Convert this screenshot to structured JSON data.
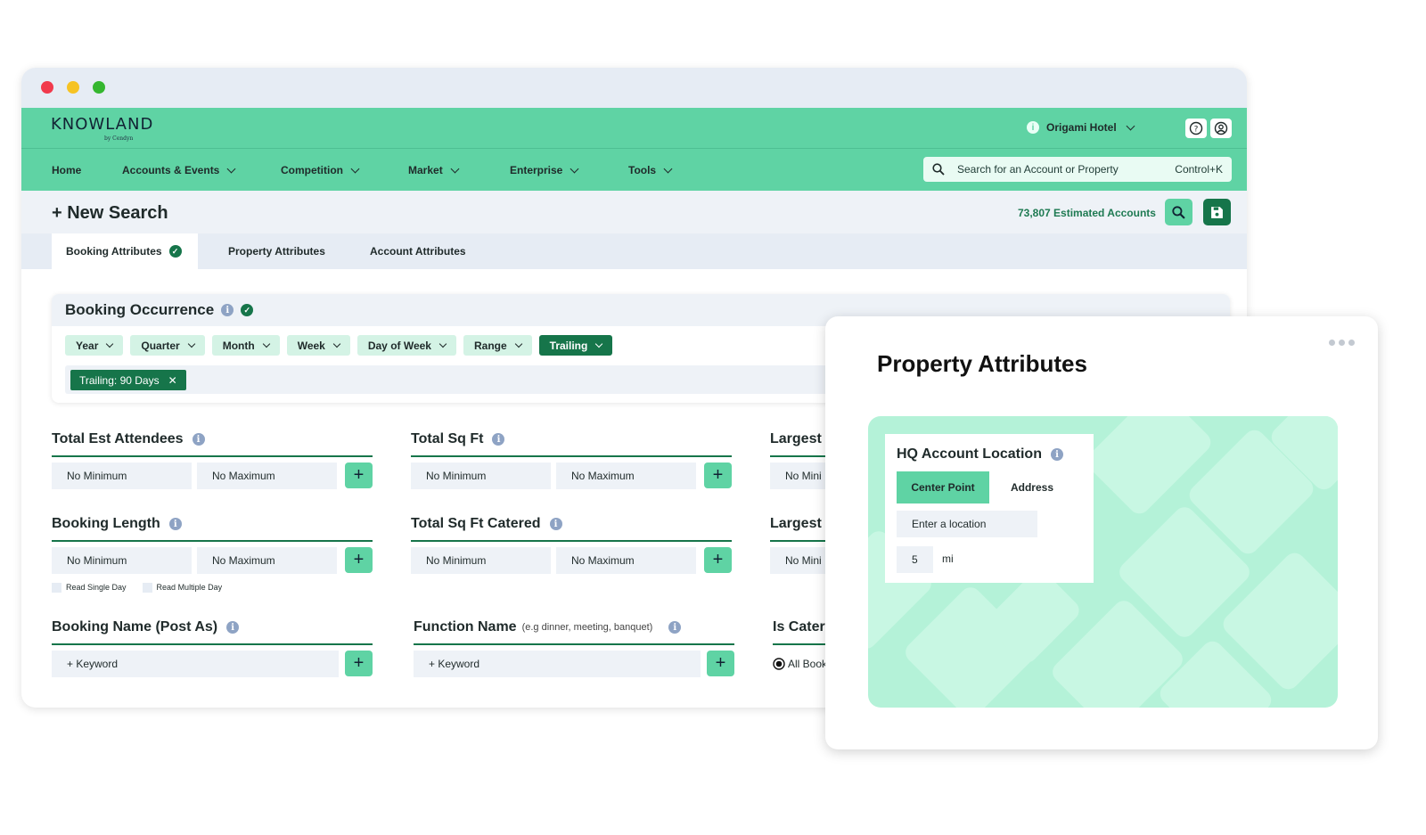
{
  "app": {
    "logo": "KNOWLAND",
    "logo_sub": "by Cendyn",
    "hotel": "Origami Hotel"
  },
  "nav": {
    "items": [
      {
        "label": "Home",
        "dropdown": false
      },
      {
        "label": "Accounts & Events",
        "dropdown": true
      },
      {
        "label": "Competition",
        "dropdown": true
      },
      {
        "label": "Market",
        "dropdown": true
      },
      {
        "label": "Enterprise",
        "dropdown": true
      },
      {
        "label": "Tools",
        "dropdown": true
      }
    ],
    "search_placeholder": "Search for an Account or Property",
    "search_shortcut": "Control+K"
  },
  "header": {
    "title": "+ New Search",
    "estimated": "73,807 Estimated Accounts"
  },
  "tabs": [
    {
      "label": "Booking Attributes",
      "active": true,
      "complete": true
    },
    {
      "label": "Property Attributes",
      "active": false
    },
    {
      "label": "Account Attributes",
      "active": false
    }
  ],
  "occurrence": {
    "title": "Booking Occurrence",
    "chips": [
      "Year",
      "Quarter",
      "Month",
      "Week",
      "Day of Week",
      "Range",
      "Trailing"
    ],
    "active_chip": "Trailing",
    "filter_tag": "Trailing: 90 Days"
  },
  "fields": {
    "attendees": {
      "label": "Total Est Attendees",
      "min": "No Minimum",
      "max": "No Maximum"
    },
    "sqft": {
      "label": "Total Sq Ft",
      "min": "No Minimum",
      "max": "No Maximum"
    },
    "largest1": {
      "label": "Largest",
      "min": "No Mini"
    },
    "length": {
      "label": "Booking Length",
      "min": "No Minimum",
      "max": "No Maximum",
      "check1": "Read Single Day",
      "check2": "Read Multiple Day"
    },
    "sqft_catered": {
      "label": "Total Sq Ft Catered",
      "min": "No Minimum",
      "max": "No Maximum"
    },
    "largest2": {
      "label": "Largest",
      "min": "No Mini"
    },
    "booking_name": {
      "label": "Booking Name (Post As)",
      "keyword": "+ Keyword"
    },
    "function_name": {
      "label": "Function Name",
      "hint": "(e.g dinner, meeting, banquet)",
      "keyword": "+ Keyword"
    },
    "is_catered": {
      "label": "Is Cater",
      "radio": "All Book"
    }
  },
  "overlay": {
    "title": "Property Attributes",
    "loc_title": "HQ Account Location",
    "seg_active": "Center Point",
    "seg_other": "Address",
    "location_placeholder": "Enter a location",
    "radius": "5",
    "unit": "mi"
  },
  "colors": {
    "brand": "#5fd3a4",
    "dark_green": "#16754a",
    "panel": "#eef2f7"
  }
}
